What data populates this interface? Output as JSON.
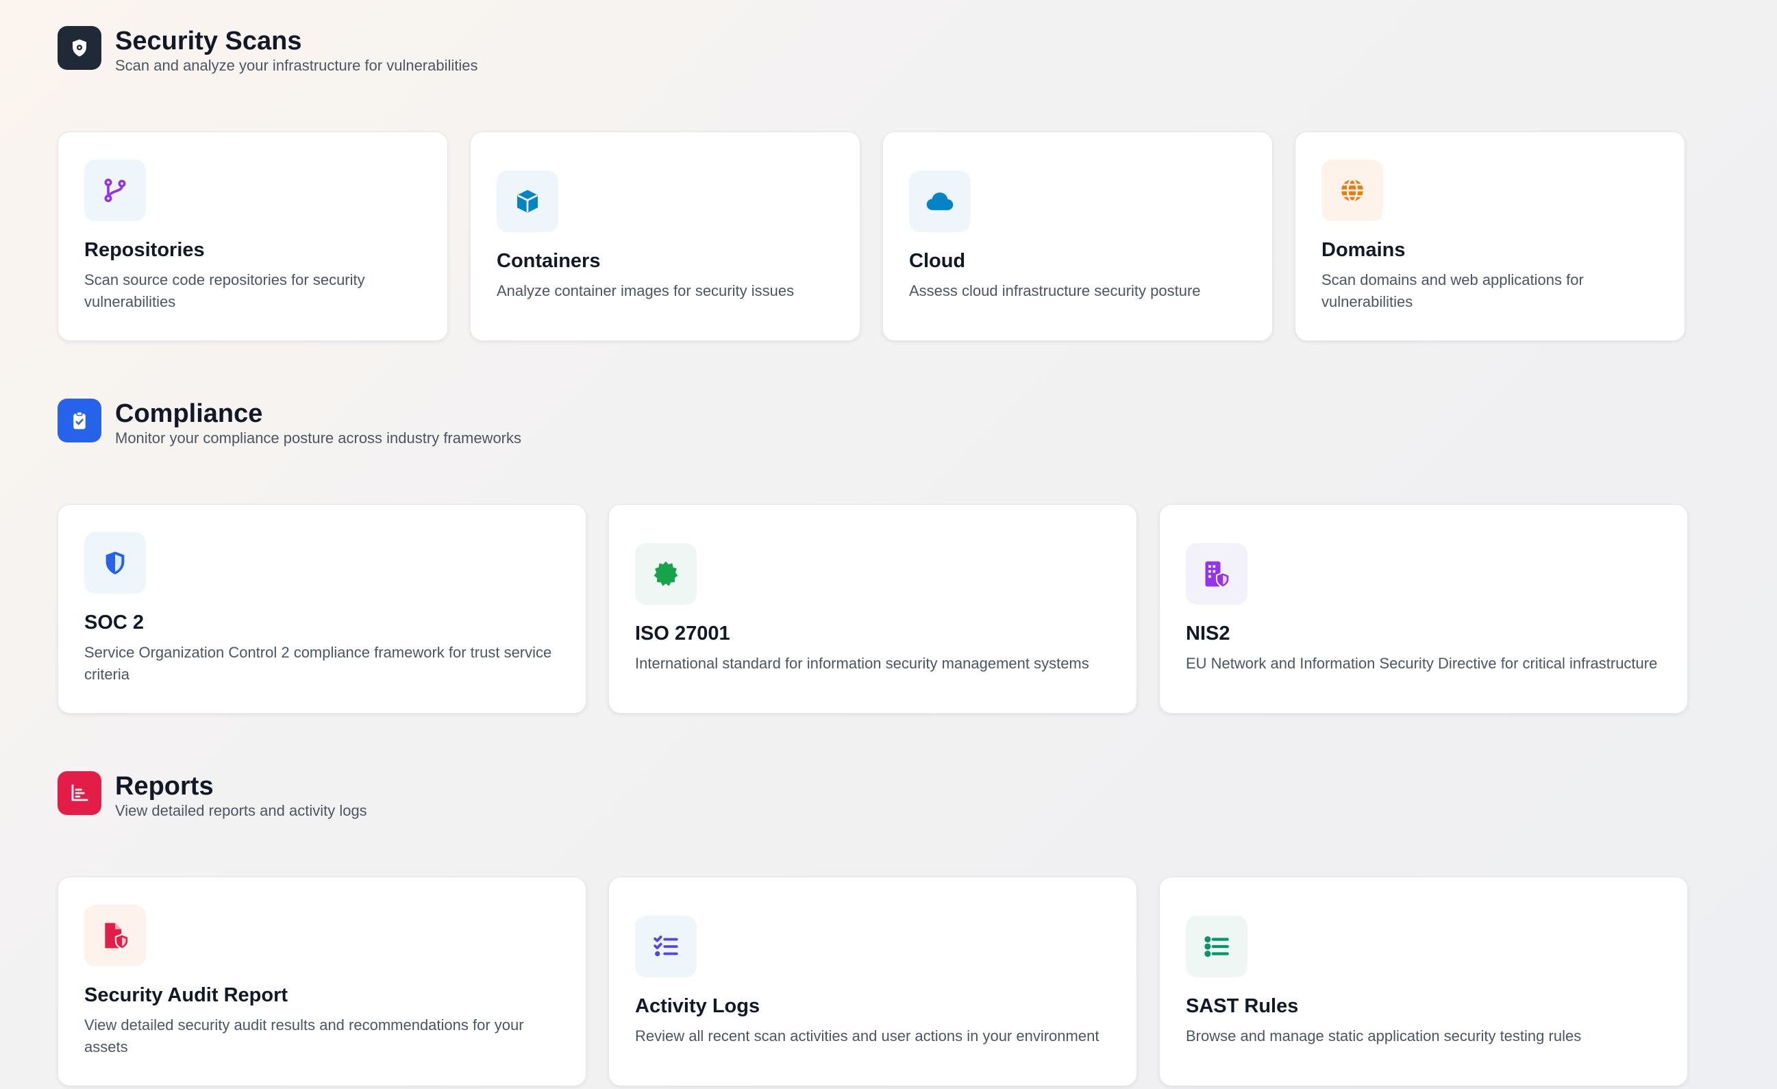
{
  "sections": [
    {
      "title": "Security Scans",
      "subtitle": "Scan and analyze your infrastructure for vulnerabilities",
      "icon": "shield-icon",
      "icon_bg": "#1f2937",
      "cards": [
        {
          "title": "Repositories",
          "description": "Scan source code repositories for security vulnerabilities",
          "icon": "git-branch-icon",
          "color": "#9333ea",
          "bg": "#eff6fb"
        },
        {
          "title": "Containers",
          "description": "Analyze container images for security issues",
          "icon": "cube-icon",
          "color": "#0284c7",
          "bg": "#eff6fb"
        },
        {
          "title": "Cloud",
          "description": "Assess cloud infrastructure security posture",
          "icon": "cloud-icon",
          "color": "#0284c7",
          "bg": "#eff6fb"
        },
        {
          "title": "Domains",
          "description": "Scan domains and web applications for vulnerabilities",
          "icon": "globe-icon",
          "color": "#ea7b0c",
          "bg": "#fdf3ea"
        }
      ]
    },
    {
      "title": "Compliance",
      "subtitle": "Monitor your compliance posture across industry frameworks",
      "icon": "clipboard-check-icon",
      "icon_bg": "#2563eb",
      "cards": [
        {
          "title": "SOC 2",
          "description": "Service Organization Control 2 compliance framework for trust service criteria",
          "icon": "shield-half-icon",
          "color": "#2563eb",
          "bg": "#eff6fb"
        },
        {
          "title": "ISO 27001",
          "description": "International standard for information security management systems",
          "icon": "badge-icon",
          "color": "#16a34a",
          "bg": "#eef7f3"
        },
        {
          "title": "NIS2",
          "description": "EU Network and Information Security Directive for critical infrastructure",
          "icon": "building-shield-icon",
          "color": "#9333ea",
          "bg": "#f3f2fa"
        }
      ]
    },
    {
      "title": "Reports",
      "subtitle": "View detailed reports and activity logs",
      "icon": "chart-icon",
      "icon_bg": "#e11d48",
      "cards": [
        {
          "title": "Security Audit Report",
          "description": "View detailed security audit results and recommendations for your assets",
          "icon": "file-shield-icon",
          "color": "#e11d48",
          "bg": "#fdf3ec"
        },
        {
          "title": "Activity Logs",
          "description": "Review all recent scan activities and user actions in your environment",
          "icon": "list-check-icon",
          "color": "#4f46e5",
          "bg": "#eff6fb"
        },
        {
          "title": "SAST Rules",
          "description": "Browse and manage static application security testing rules",
          "icon": "list-icon",
          "color": "#059669",
          "bg": "#eef7f3"
        }
      ]
    }
  ]
}
